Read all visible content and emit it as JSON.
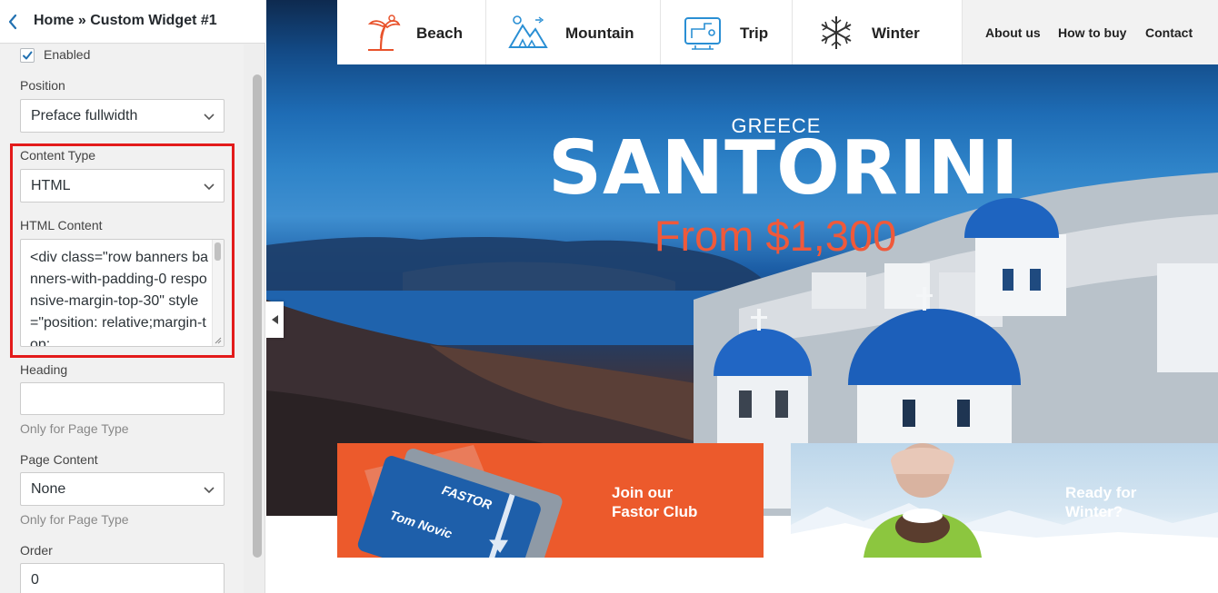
{
  "sidebar": {
    "title": "Home » Custom Widget #1",
    "enabled_label": "Enabled",
    "position_label": "Position",
    "position_value": "Preface fullwidth",
    "content_type_label": "Content Type",
    "content_type_value": "HTML",
    "html_content_label": "HTML Content",
    "html_content_value": "<div class=\"row banners banners-with-padding-0 responsive-margin-top-30\" style=\"position: relative;margin-top:",
    "heading_label": "Heading",
    "heading_value": "",
    "heading_hint": "Only for Page Type",
    "page_content_label": "Page Content",
    "page_content_value": "None",
    "page_content_hint": "Only for Page Type",
    "order_label": "Order",
    "order_value": "0"
  },
  "nav": {
    "categories": [
      {
        "label": "Beach",
        "icon": "palm-tree-icon"
      },
      {
        "label": "Mountain",
        "icon": "mountain-icon"
      },
      {
        "label": "Trip",
        "icon": "map-route-icon"
      },
      {
        "label": "Winter",
        "icon": "snowflake-icon"
      }
    ],
    "links": [
      "About us",
      "How to buy",
      "Contact"
    ]
  },
  "hero": {
    "subtitle": "GREECE",
    "title": "SANTORINI",
    "price": "From $1,300"
  },
  "banners": [
    {
      "text": "Join our Fastor Club",
      "card_brand": "FASTOR",
      "card_name": "Tom Novic"
    },
    {
      "text": "Ready for Winter?"
    }
  ],
  "colors": {
    "accent": "#f0593a",
    "highlight": "#e31b1b",
    "checkbox": "#2271b1",
    "banner_orange": "#ec5a2c"
  }
}
